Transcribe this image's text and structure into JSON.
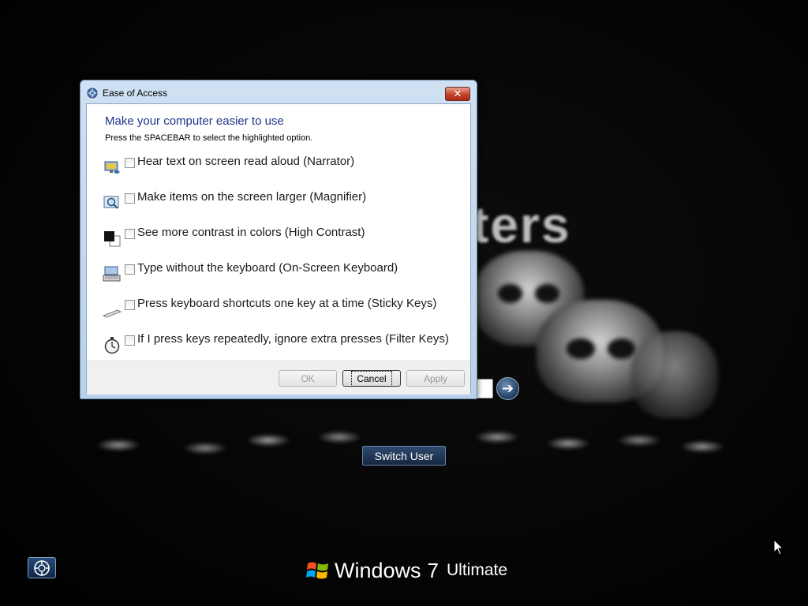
{
  "background": {
    "art_text": "ters"
  },
  "logon": {
    "switch_user_label": "Switch User",
    "go_arrow": "➔"
  },
  "branding": {
    "windows": "Windows",
    "version": "7",
    "edition": "Ultimate"
  },
  "dialog": {
    "title": "Ease of Access",
    "close_glyph": "✕",
    "heading": "Make your computer easier to use",
    "instruction": "Press the SPACEBAR to select the highlighted option.",
    "options": [
      {
        "label": "Hear text on screen read aloud (Narrator)",
        "icon": "narrator-icon",
        "checked": false
      },
      {
        "label": "Make items on the screen larger (Magnifier)",
        "icon": "magnifier-icon",
        "checked": false
      },
      {
        "label": "See more contrast in colors (High Contrast)",
        "icon": "high-contrast-icon",
        "checked": false
      },
      {
        "label": "Type without the keyboard (On-Screen Keyboard)",
        "icon": "on-screen-keyboard-icon",
        "checked": false
      },
      {
        "label": "Press keyboard shortcuts one key at a time (Sticky Keys)",
        "icon": "sticky-keys-icon",
        "checked": false
      },
      {
        "label": "If I press keys repeatedly, ignore extra presses (Filter Keys)",
        "icon": "filter-keys-icon",
        "checked": false
      }
    ],
    "buttons": {
      "ok": "OK",
      "cancel": "Cancel",
      "apply": "Apply"
    }
  },
  "colors": {
    "heading": "#1e3287",
    "close_button": "#c3422a",
    "switch_user": "#16283f"
  }
}
